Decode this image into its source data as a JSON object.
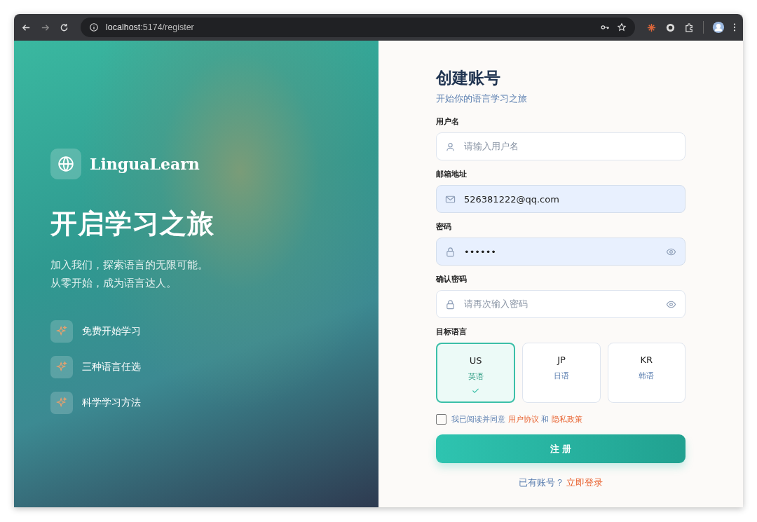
{
  "browser": {
    "url_host": "localhost",
    "url_path": ":5174/register"
  },
  "brand": {
    "name": "LinguaLearn"
  },
  "hero": {
    "title": "开启学习之旅",
    "lines": [
      "加入我们，探索语言的无限可能。",
      "从零开始，成为语言达人。"
    ]
  },
  "features": [
    {
      "label": "免费开始学习"
    },
    {
      "label": "三种语言任选"
    },
    {
      "label": "科学学习方法"
    }
  ],
  "form": {
    "title": "创建账号",
    "subtitle": "开始你的语言学习之旅",
    "fields": [
      {
        "label": "用户名",
        "kind": "user",
        "placeholder": "请输入用户名",
        "autofilled": false,
        "eye": false
      },
      {
        "label": "邮箱地址",
        "kind": "mail",
        "value": "526381222@qq.com",
        "autofilled": true,
        "eye": false
      },
      {
        "label": "密码",
        "kind": "lock",
        "value": "••••••",
        "autofilled": true,
        "eye": true
      },
      {
        "label": "确认密码",
        "kind": "lock",
        "placeholder": "请再次输入密码",
        "autofilled": false,
        "eye": true
      }
    ],
    "language_label": "目标语言",
    "languages": [
      {
        "code": "US",
        "name": "英语",
        "selected": true
      },
      {
        "code": "JP",
        "name": "日语",
        "selected": false
      },
      {
        "code": "KR",
        "name": "韩语",
        "selected": false
      }
    ],
    "agreement": {
      "checked": false,
      "text": "我已阅读并同意",
      "link_1": "用户协议",
      "joiner": "和",
      "link_2": "隐私政策"
    },
    "submit": "注 册",
    "login_prompt": "已有账号？",
    "login_link": "立即登录"
  }
}
